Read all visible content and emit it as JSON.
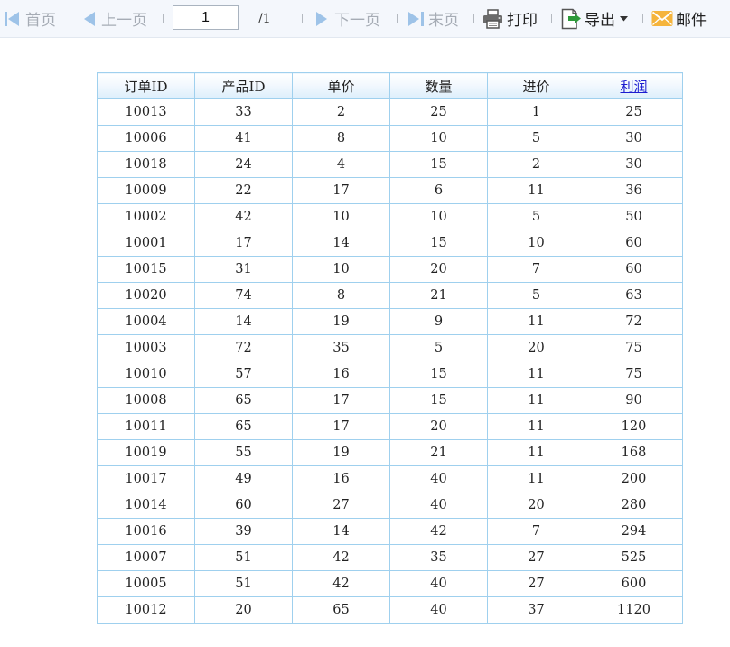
{
  "toolbar": {
    "first_label": "首页",
    "prev_label": "上一页",
    "page_value": "1",
    "page_total": "/1",
    "next_label": "下一页",
    "last_label": "末页",
    "print_label": "打印",
    "export_label": "导出",
    "mail_label": "邮件"
  },
  "icons": {
    "first": "first-page-icon",
    "prev": "prev-page-icon",
    "next": "next-page-icon",
    "last": "last-page-icon",
    "print": "printer-icon",
    "export": "export-icon",
    "dropdown": "dropdown-caret-icon",
    "mail": "mail-envelope-icon"
  },
  "colors": {
    "disabled_text": "#a6acb5",
    "enabled_icon": "#555555",
    "mail_icon": "#f5b43c",
    "export_arrow": "#2e9a3a",
    "table_border": "#9fd0ee",
    "header_bg": "#dceefb",
    "link": "#1c1cd0"
  },
  "table": {
    "columns": [
      "订单ID",
      "产品ID",
      "单价",
      "数量",
      "进价",
      "利润"
    ],
    "sortable_column_index": 5,
    "rows": [
      [
        "10013",
        "33",
        "2",
        "25",
        "1",
        "25"
      ],
      [
        "10006",
        "41",
        "8",
        "10",
        "5",
        "30"
      ],
      [
        "10018",
        "24",
        "4",
        "15",
        "2",
        "30"
      ],
      [
        "10009",
        "22",
        "17",
        "6",
        "11",
        "36"
      ],
      [
        "10002",
        "42",
        "10",
        "10",
        "5",
        "50"
      ],
      [
        "10001",
        "17",
        "14",
        "15",
        "10",
        "60"
      ],
      [
        "10015",
        "31",
        "10",
        "20",
        "7",
        "60"
      ],
      [
        "10020",
        "74",
        "8",
        "21",
        "5",
        "63"
      ],
      [
        "10004",
        "14",
        "19",
        "9",
        "11",
        "72"
      ],
      [
        "10003",
        "72",
        "35",
        "5",
        "20",
        "75"
      ],
      [
        "10010",
        "57",
        "16",
        "15",
        "11",
        "75"
      ],
      [
        "10008",
        "65",
        "17",
        "15",
        "11",
        "90"
      ],
      [
        "10011",
        "65",
        "17",
        "20",
        "11",
        "120"
      ],
      [
        "10019",
        "55",
        "19",
        "21",
        "11",
        "168"
      ],
      [
        "10017",
        "49",
        "16",
        "40",
        "11",
        "200"
      ],
      [
        "10014",
        "60",
        "27",
        "40",
        "20",
        "280"
      ],
      [
        "10016",
        "39",
        "14",
        "42",
        "7",
        "294"
      ],
      [
        "10007",
        "51",
        "42",
        "35",
        "27",
        "525"
      ],
      [
        "10005",
        "51",
        "42",
        "40",
        "27",
        "600"
      ],
      [
        "10012",
        "20",
        "65",
        "40",
        "37",
        "1120"
      ]
    ]
  }
}
